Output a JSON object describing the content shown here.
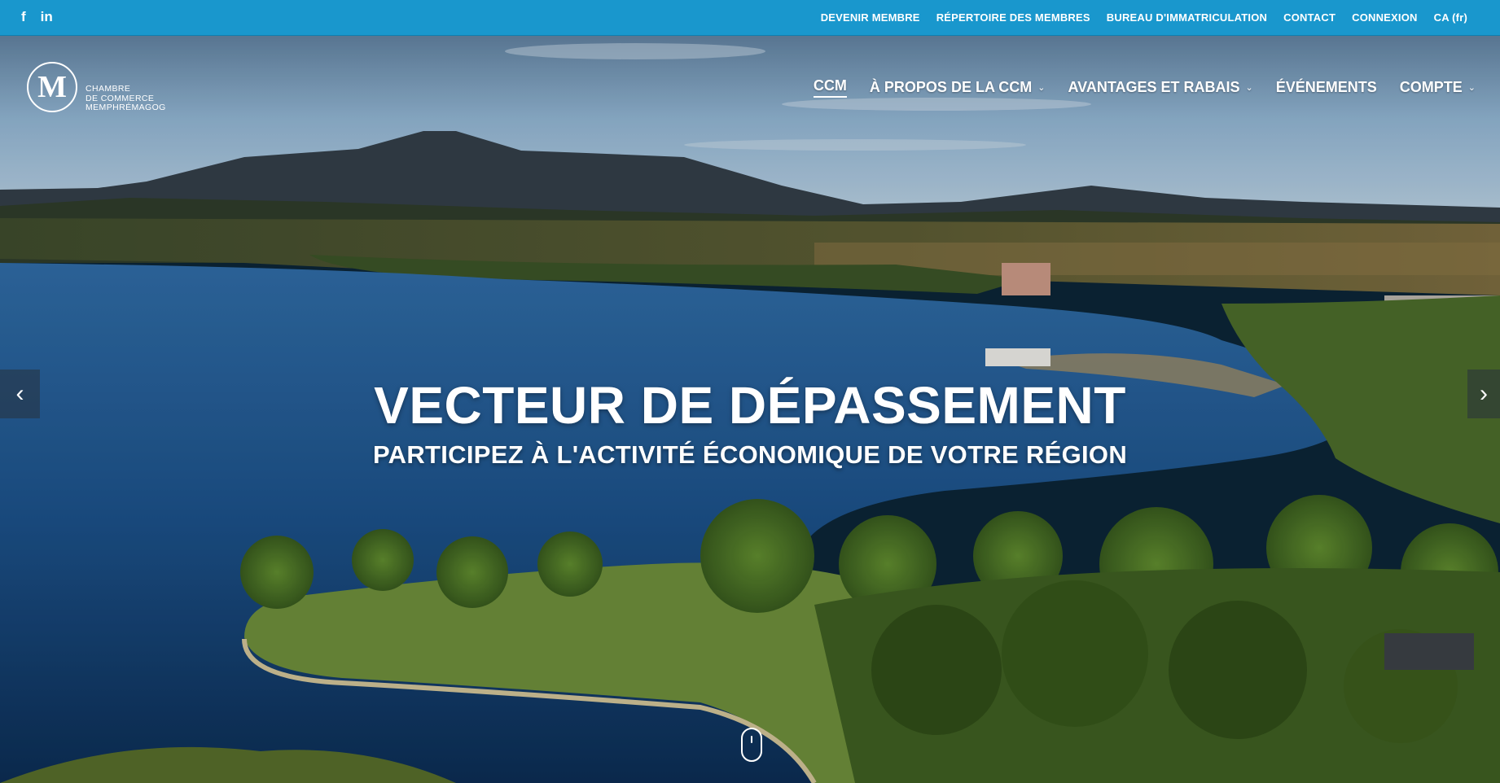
{
  "topbar": {
    "social": [
      {
        "icon": "facebook-icon",
        "label": "f"
      },
      {
        "icon": "linkedin-icon",
        "label": "in"
      }
    ],
    "links": [
      "DEVENIR MEMBRE",
      "RÉPERTOIRE DES MEMBRES",
      "BUREAU D'IMMATRICULATION",
      "CONTACT",
      "CONNEXION",
      "CA (fr)"
    ],
    "language_label": "CA (fr)",
    "bg_color": "#1997cd"
  },
  "logo": {
    "mark": "M",
    "line1": "CHAMBRE",
    "line2": "DE COMMERCE",
    "line3": "MEMPHRÉMAGOG"
  },
  "nav": {
    "items": [
      {
        "label": "CCM",
        "dropdown": false,
        "active": true
      },
      {
        "label": "À PROPOS DE LA CCM",
        "dropdown": true
      },
      {
        "label": "AVANTAGES ET RABAIS",
        "dropdown": true
      },
      {
        "label": "ÉVÉNEMENTS",
        "dropdown": false
      },
      {
        "label": "COMPTE",
        "dropdown": true
      }
    ],
    "chevron": "⌄"
  },
  "hero": {
    "headline": "VECTEUR DE DÉPASSEMENT",
    "subline": "PARTICIPEZ À L'ACTIVITÉ ÉCONOMIQUE DE VOTRE RÉGION",
    "prev_glyph": "‹",
    "next_glyph": "›"
  }
}
